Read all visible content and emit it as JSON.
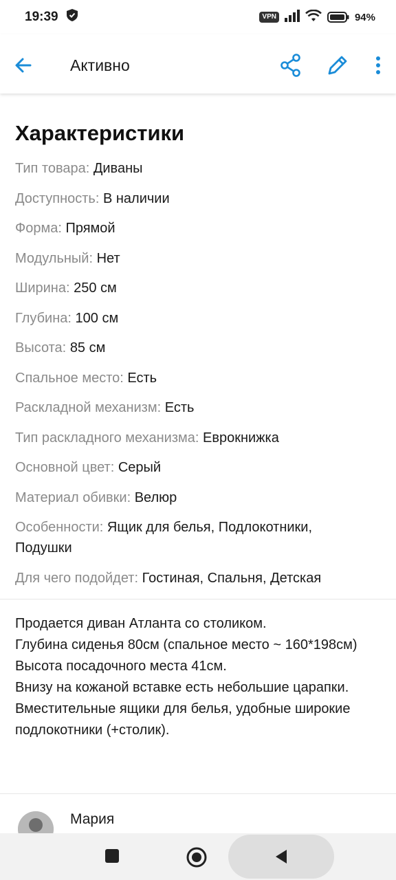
{
  "status_bar": {
    "time": "19:39",
    "vpn": "VPN",
    "battery": "94%",
    "icons": [
      "shield-icon",
      "signal-icon",
      "wifi-icon",
      "battery-icon"
    ]
  },
  "app_bar": {
    "title": "Активно",
    "icons": [
      "back-arrow-icon",
      "share-icon",
      "edit-pencil-icon",
      "more-vert-icon"
    ],
    "accent_color": "#1a8cd8"
  },
  "characteristics": {
    "title": "Характеристики",
    "items": [
      {
        "key": "Тип товара:",
        "value": "Диваны"
      },
      {
        "key": "Доступность:",
        "value": "В наличии"
      },
      {
        "key": "Форма:",
        "value": "Прямой"
      },
      {
        "key": "Модульный:",
        "value": "Нет"
      },
      {
        "key": "Ширина:",
        "value": "250 см"
      },
      {
        "key": "Глубина:",
        "value": "100 см"
      },
      {
        "key": "Высота:",
        "value": "85 см"
      },
      {
        "key": "Спальное место:",
        "value": "Есть"
      },
      {
        "key": "Раскладной механизм:",
        "value": "Есть"
      },
      {
        "key": "Тип раскладного механизма:",
        "value": "Еврокнижка"
      },
      {
        "key": "Основной цвет:",
        "value": "Серый"
      },
      {
        "key": "Материал обивки:",
        "value": "Велюр"
      },
      {
        "key": "Особенности:",
        "value": "Ящик для белья, Подлокотники, Подушки"
      },
      {
        "key": "Для чего подойдет:",
        "value": "Гостиная, Спальня, Детская"
      }
    ]
  },
  "description": {
    "lines": [
      "Продается диван Атланта со столиком.",
      "Глубина сиденья 80см (спальное место ~ 160*198см)",
      "Высота посадочного места 41см.",
      "Внизу на кожаной вставке есть небольшие царапки.",
      "Вместительные ящики для белья, удобные широкие подлокотники (+столик)."
    ]
  },
  "seller": {
    "name": "Мария"
  },
  "nav_bar": {
    "icons": [
      "recents-square-icon",
      "home-circle-icon",
      "back-triangle-icon"
    ]
  }
}
